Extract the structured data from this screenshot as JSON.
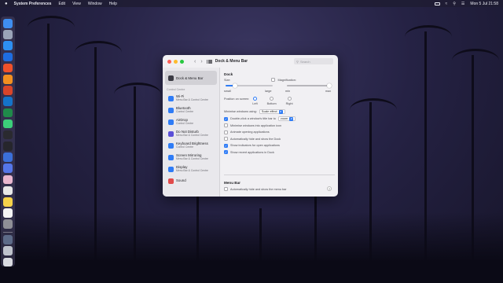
{
  "menubar": {
    "app_name": "System Preferences",
    "items": [
      "Edit",
      "View",
      "Window",
      "Help"
    ],
    "clock": "Mon 5 Jul  21:58"
  },
  "window": {
    "title": "Dock & Menu Bar",
    "search_placeholder": "Search"
  },
  "sidebar": {
    "selected": {
      "title": "Dock & Menu Bar",
      "icon": "dock-menubar-icon",
      "color": "#3b3b44"
    },
    "section_label": "Control Centre",
    "items": [
      {
        "title": "Wi-Fi",
        "sub": "Menu Bar & Control Centre",
        "icon": "wifi-icon",
        "color": "#2f7cf6"
      },
      {
        "title": "Bluetooth",
        "sub": "Control Centre",
        "icon": "bluetooth-icon",
        "color": "#2f7cf6"
      },
      {
        "title": "AirDrop",
        "sub": "Control Centre",
        "icon": "airdrop-icon",
        "color": "#2f7cf6"
      },
      {
        "title": "Do Not Disturb",
        "sub": "Menu Bar & Control Centre",
        "icon": "moon-icon",
        "color": "#5b4fd8"
      },
      {
        "title": "Keyboard Brightness",
        "sub": "Control Centre",
        "icon": "keyboard-brightness-icon",
        "color": "#2f7cf6"
      },
      {
        "title": "Screen Mirroring",
        "sub": "Menu Bar & Control Centre",
        "icon": "screen-mirroring-icon",
        "color": "#2f7cf6"
      },
      {
        "title": "Display",
        "sub": "Menu Bar & Control Centre",
        "icon": "display-icon",
        "color": "#2f7cf6"
      },
      {
        "title": "Sound",
        "sub": "",
        "icon": "sound-icon",
        "color": "#e14a4a"
      }
    ]
  },
  "dock_section": {
    "heading": "Dock",
    "size_label": "Size:",
    "size_min": "small",
    "size_max": "large",
    "size_value": 0.2,
    "magnification_label": "Magnification:",
    "mag_min": "min",
    "mag_max": "max",
    "mag_value": 1.0,
    "magnification_checked": false,
    "position_label": "Position on screen:",
    "positions": [
      {
        "label": "Left",
        "selected": true
      },
      {
        "label": "Bottom",
        "selected": false
      },
      {
        "label": "Right",
        "selected": false
      }
    ],
    "minimise_label": "Minimise windows using:",
    "minimise_value": "Scale effect",
    "double_click_label": "Double-click a window's title bar to",
    "double_click_value": "zoom",
    "double_click_checked": true,
    "checkboxes": [
      {
        "label": "Minimise windows into application icon",
        "checked": false
      },
      {
        "label": "Animate opening applications",
        "checked": false
      },
      {
        "label": "Automatically hide and show the Dock",
        "checked": false
      },
      {
        "label": "Show indicators for open applications",
        "checked": true
      },
      {
        "label": "Show recent applications in Dock",
        "checked": true
      }
    ]
  },
  "menubar_section": {
    "heading": "Menu Bar",
    "autohide_label": "Automatically hide and show the menu bar",
    "autohide_checked": false
  },
  "dock_apps": [
    {
      "name": "finder",
      "color": "#3f8ef0"
    },
    {
      "name": "launchpad",
      "color": "#9aa4b8"
    },
    {
      "name": "safari",
      "color": "#2d8ff1"
    },
    {
      "name": "app-store",
      "color": "#1e6de0"
    },
    {
      "name": "brave",
      "color": "#f0512a"
    },
    {
      "name": "sublime",
      "color": "#f28f20"
    },
    {
      "name": "office",
      "color": "#d8452a"
    },
    {
      "name": "outlook",
      "color": "#1573c9"
    },
    {
      "name": "excel",
      "color": "#1f8a4a"
    },
    {
      "name": "terminal-green",
      "color": "#3ccf7a"
    },
    {
      "name": "app-dark",
      "color": "#2a2a30"
    },
    {
      "name": "terminal",
      "color": "#26262c"
    },
    {
      "name": "affinity",
      "color": "#3b6fd8"
    },
    {
      "name": "app-blue",
      "color": "#5576e8"
    },
    {
      "name": "photos",
      "color": "#e9b7cf"
    },
    {
      "name": "chrome",
      "color": "#e8e8e8"
    },
    {
      "name": "notes",
      "color": "#f5d24a"
    },
    {
      "name": "calendar",
      "color": "#f4f4f4"
    },
    {
      "name": "settings",
      "color": "#8f8f96"
    },
    {
      "name": "downloads",
      "color": "#5d6b88"
    },
    {
      "name": "folder",
      "color": "#bfc3cc"
    },
    {
      "name": "trash",
      "color": "#d9dbe0"
    }
  ]
}
